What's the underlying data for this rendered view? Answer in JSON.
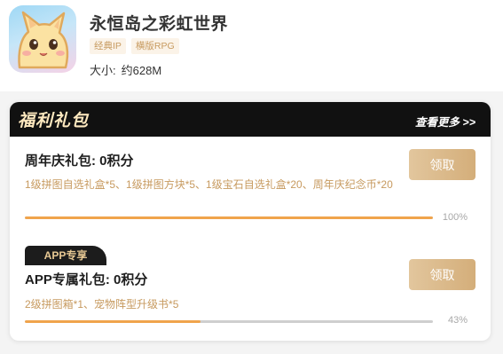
{
  "game": {
    "title": "永恒岛之彩虹世界",
    "tags": [
      "经典IP",
      "横版RPG"
    ],
    "size_label": "大小:",
    "size_value": "约628M"
  },
  "welfare": {
    "title": "福利礼包",
    "view_more": "查看更多 >>",
    "packages": [
      {
        "name": "周年庆礼包: 0积分",
        "desc": "1级拼图自选礼盒*5、1级拼图方块*5、1级宝石自选礼盒*20、周年庆纪念币*20",
        "button": "领取",
        "progress": 100,
        "progress_label": "100%"
      },
      {
        "badge": "APP专享",
        "name": "APP专属礼包: 0积分",
        "desc": "2级拼图箱*1、宠物阵型升级书*5",
        "button": "领取",
        "progress": 43,
        "progress_label": "43%"
      }
    ]
  },
  "colors": {
    "accent_gold": "#d4ae7a",
    "desc_gold": "#c79a5f",
    "progress": "#f0a44c",
    "header_dark": "#111111"
  }
}
